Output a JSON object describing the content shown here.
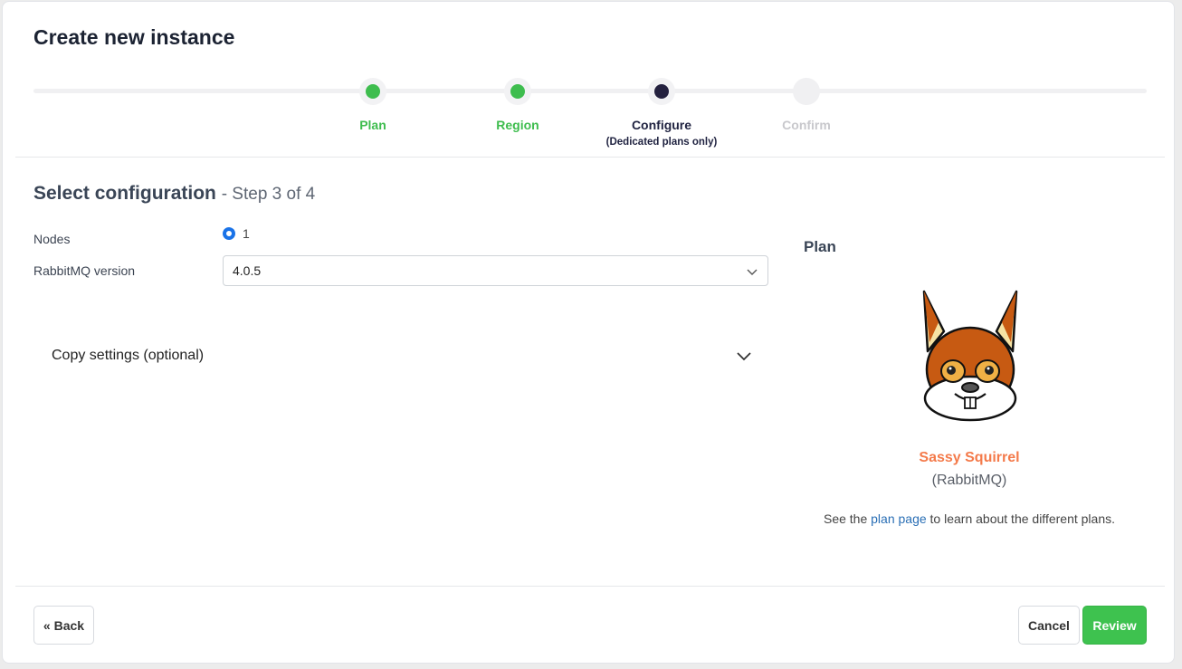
{
  "page": {
    "title": "Create new instance"
  },
  "stepper": {
    "steps": [
      {
        "label": "Plan",
        "sub": "",
        "state": "done"
      },
      {
        "label": "Region",
        "sub": "",
        "state": "done"
      },
      {
        "label": "Configure",
        "sub": "(Dedicated plans only)",
        "state": "current"
      },
      {
        "label": "Confirm",
        "sub": "",
        "state": "future"
      }
    ]
  },
  "section": {
    "title": "Select configuration",
    "step": "- Step 3 of 4"
  },
  "form": {
    "nodes_label": "Nodes",
    "nodes_value": "1",
    "version_label": "RabbitMQ version",
    "version_value": "4.0.5",
    "copy_settings_label": "Copy settings (optional)"
  },
  "plan_panel": {
    "heading": "Plan",
    "plan_name": "Sassy Squirrel",
    "plan_type": "(RabbitMQ)",
    "info_prefix": "See the",
    "info_link": "plan page",
    "info_suffix": "to learn about the different plans."
  },
  "footer": {
    "back_label": "« Back",
    "cancel_label": "Cancel",
    "review_label": "Review"
  },
  "colors": {
    "success": "#3ebd4e",
    "current": "#24213f",
    "accent": "#f47a4a",
    "link": "#2a6fb5",
    "radio": "#1a73e8"
  },
  "icons": {
    "select": "chevron-down-icon",
    "copy": "chevron-down-icon",
    "mascot": "squirrel-icon"
  }
}
